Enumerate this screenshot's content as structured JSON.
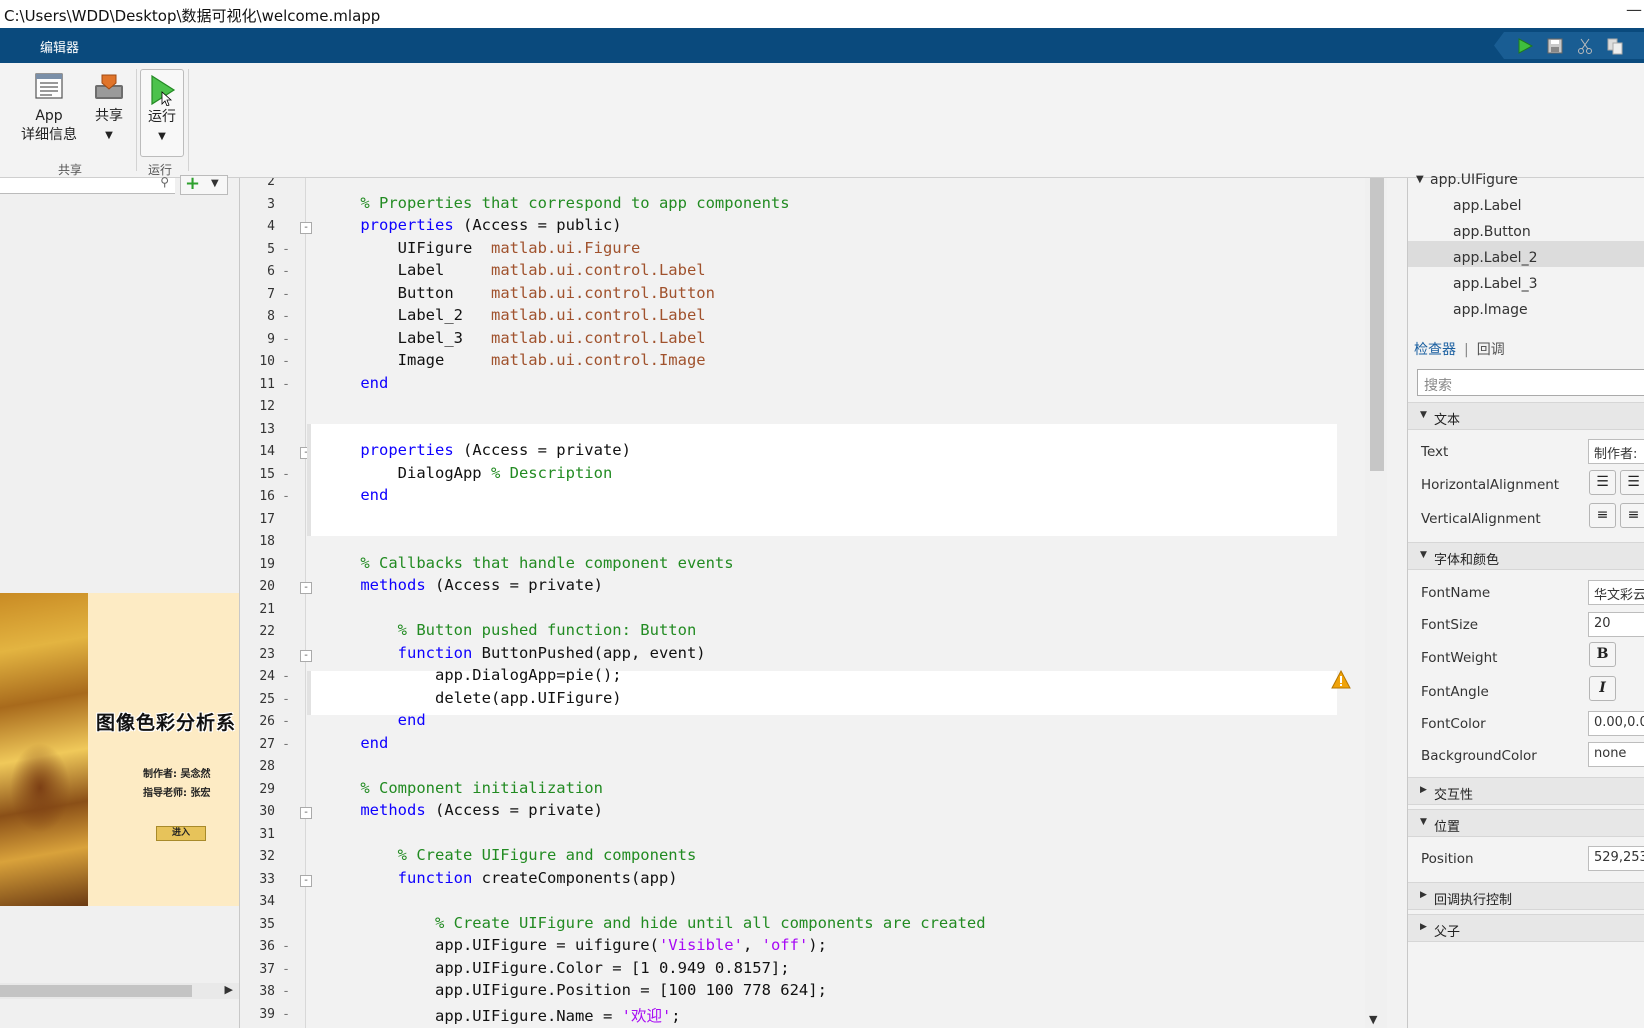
{
  "window": {
    "title": "C:\\Users\\WDD\\Desktop\\数据可视化\\welcome.mlapp",
    "minimize_glyph": "—"
  },
  "ribbon": {
    "tab": "编辑器",
    "quick_access": [
      "run-icon",
      "save-icon",
      "cut-icon",
      "copy-icon"
    ],
    "tools": {
      "app_details_line1": "App",
      "app_details_line2": "详细信息",
      "share_label": "共享",
      "run_label": "运行"
    },
    "groups": {
      "share": "共享",
      "run": "运行"
    }
  },
  "left_panel": {
    "preview": {
      "title": "图像色彩分析系",
      "line1": "制作者: 吴念然",
      "line2": "指导老师: 张宏",
      "button": "进入"
    }
  },
  "editor": {
    "lines": [
      {
        "n": "2",
        "m": "",
        "f": "",
        "code": ""
      },
      {
        "n": "3",
        "m": "",
        "f": "",
        "code": "    <span class='cm'>% Properties that correspond to app components</span>"
      },
      {
        "n": "4",
        "m": "",
        "f": "-",
        "code": "    <span class='kw'>properties</span> (Access = public)"
      },
      {
        "n": "5",
        "m": "-",
        "f": "",
        "code": "        UIFigure  <span class='ty'>matlab.ui.Figure</span>"
      },
      {
        "n": "6",
        "m": "-",
        "f": "",
        "code": "        Label     <span class='ty'>matlab.ui.control.Label</span>"
      },
      {
        "n": "7",
        "m": "-",
        "f": "",
        "code": "        Button    <span class='ty'>matlab.ui.control.Button</span>"
      },
      {
        "n": "8",
        "m": "-",
        "f": "",
        "code": "        Label_2   <span class='ty'>matlab.ui.control.Label</span>"
      },
      {
        "n": "9",
        "m": "-",
        "f": "",
        "code": "        Label_3   <span class='ty'>matlab.ui.control.Label</span>"
      },
      {
        "n": "10",
        "m": "-",
        "f": "",
        "code": "        Image     <span class='ty'>matlab.ui.control.Image</span>"
      },
      {
        "n": "11",
        "m": "-",
        "f": "",
        "code": "    <span class='kw'>end</span>"
      },
      {
        "n": "12",
        "m": "",
        "f": "",
        "code": ""
      },
      {
        "n": "13",
        "m": "",
        "f": "",
        "code": ""
      },
      {
        "n": "14",
        "m": "",
        "f": "-",
        "code": "    <span class='kw'>properties</span> (Access = private)"
      },
      {
        "n": "15",
        "m": "-",
        "f": "",
        "code": "        DialogApp <span class='cm'>% Description</span>"
      },
      {
        "n": "16",
        "m": "-",
        "f": "",
        "code": "    <span class='kw'>end</span>"
      },
      {
        "n": "17",
        "m": "",
        "f": "",
        "code": ""
      },
      {
        "n": "18",
        "m": "",
        "f": "",
        "code": ""
      },
      {
        "n": "19",
        "m": "",
        "f": "",
        "code": "    <span class='cm'>% Callbacks that handle component events</span>"
      },
      {
        "n": "20",
        "m": "",
        "f": "-",
        "code": "    <span class='kw'>methods</span> (Access = private)"
      },
      {
        "n": "21",
        "m": "",
        "f": "",
        "code": ""
      },
      {
        "n": "22",
        "m": "",
        "f": "",
        "code": "        <span class='cm'>% Button pushed function: Button</span>"
      },
      {
        "n": "23",
        "m": "",
        "f": "-",
        "code": "        <span class='kw'>function</span> ButtonPushed(app, event)"
      },
      {
        "n": "24",
        "m": "-",
        "f": "",
        "code": "            app.DialogApp=pie();"
      },
      {
        "n": "25",
        "m": "-",
        "f": "",
        "code": "            delete(app.UIFigure)"
      },
      {
        "n": "26",
        "m": "-",
        "f": "",
        "code": "        <span class='kw'>end</span>"
      },
      {
        "n": "27",
        "m": "-",
        "f": "",
        "code": "    <span class='kw'>end</span>"
      },
      {
        "n": "28",
        "m": "",
        "f": "",
        "code": ""
      },
      {
        "n": "29",
        "m": "",
        "f": "",
        "code": "    <span class='cm'>% Component initialization</span>"
      },
      {
        "n": "30",
        "m": "",
        "f": "-",
        "code": "    <span class='kw'>methods</span> (Access = private)"
      },
      {
        "n": "31",
        "m": "",
        "f": "",
        "code": ""
      },
      {
        "n": "32",
        "m": "",
        "f": "",
        "code": "        <span class='cm'>% Create UIFigure and components</span>"
      },
      {
        "n": "33",
        "m": "",
        "f": "-",
        "code": "        <span class='kw'>function</span> createComponents(app)"
      },
      {
        "n": "34",
        "m": "",
        "f": "",
        "code": ""
      },
      {
        "n": "35",
        "m": "",
        "f": "",
        "code": "            <span class='cm'>% Create UIFigure and hide until all components are created</span>"
      },
      {
        "n": "36",
        "m": "-",
        "f": "",
        "code": "            app.UIFigure = uifigure(<span class='st'>'Visible'</span>, <span class='st'>'off'</span>);"
      },
      {
        "n": "37",
        "m": "-",
        "f": "",
        "code": "            app.UIFigure.Color = [1 0.949 0.8157];"
      },
      {
        "n": "38",
        "m": "-",
        "f": "",
        "code": "            app.UIFigure.Position = [100 100 778 624];"
      },
      {
        "n": "39",
        "m": "-",
        "f": "",
        "code": "            app.UIFigure.Name = <span class='st'>'欢迎'</span>;"
      }
    ]
  },
  "component_browser": {
    "root": "app.UIFigure",
    "children": [
      "app.Label",
      "app.Button",
      "app.Label_2",
      "app.Label_3",
      "app.Image"
    ],
    "selected": "app.Label_2"
  },
  "inspector": {
    "tab_active": "检查器",
    "tab_inactive": "回调",
    "search_placeholder": "搜索",
    "sections": {
      "text": "文本",
      "font": "字体和颜色",
      "interactivity": "交互性",
      "position": "位置",
      "callback": "回调执行控制",
      "parent": "父子"
    },
    "props": {
      "text_label": "Text",
      "text_value": "制作者:",
      "halign_label": "HorizontalAlignment",
      "valign_label": "VerticalAlignment",
      "fontname_label": "FontName",
      "fontname_value": "华文彩云",
      "fontsize_label": "FontSize",
      "fontsize_value": "20",
      "fontweight_label": "FontWeight",
      "fontweight_btn": "B",
      "fontangle_label": "FontAngle",
      "fontangle_btn": "I",
      "fontcolor_label": "FontColor",
      "fontcolor_value": "0.00,0.0",
      "bgcolor_label": "BackgroundColor",
      "bgcolor_value": "none",
      "position_label": "Position",
      "position_value": "529,253"
    }
  },
  "colors": {
    "ribbon_blue": "#0a4a7d",
    "keyword": "#0e00ff",
    "comment": "#228b22",
    "string": "#a709f5",
    "type": "#a0522d",
    "inspector_tab": "#1a5fa0"
  }
}
